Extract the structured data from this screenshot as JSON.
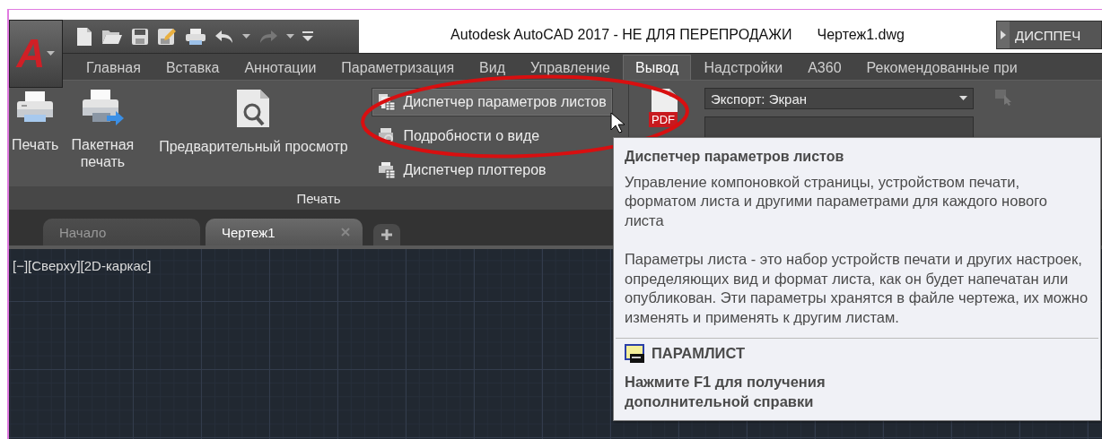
{
  "window": {
    "logo": "A",
    "title": "Autodesk AutoCAD 2017 - НЕ ДЛЯ ПЕРЕПРОДАЖИ",
    "file": "Чертеж1.dwg",
    "search_box": "ДИСППЕЧ"
  },
  "ribbon_tabs": [
    {
      "label": "Главная",
      "selected": false
    },
    {
      "label": "Вставка",
      "selected": false
    },
    {
      "label": "Аннотации",
      "selected": false
    },
    {
      "label": "Параметризация",
      "selected": false
    },
    {
      "label": "Вид",
      "selected": false
    },
    {
      "label": "Управление",
      "selected": false
    },
    {
      "label": "Вывод",
      "selected": true
    },
    {
      "label": "Надстройки",
      "selected": false
    },
    {
      "label": "А360",
      "selected": false
    },
    {
      "label": "Рекомендованные при",
      "selected": false
    }
  ],
  "print_panel": {
    "title": "Печать",
    "large_buttons": [
      {
        "kind": "print",
        "label": "Печать"
      },
      {
        "kind": "batch",
        "label": "Пакетная печать"
      },
      {
        "kind": "preview",
        "label": "Предварительный просмотр"
      }
    ],
    "small_buttons": [
      {
        "kind": "pagesetup",
        "label": "Диспетчер параметров листов",
        "highlighted": true
      },
      {
        "kind": "viewdetails",
        "label": "Подробности о виде",
        "highlighted": false
      },
      {
        "kind": "plotter",
        "label": "Диспетчер плоттеров",
        "highlighted": false
      }
    ]
  },
  "export_panel": {
    "icon_label": "PDF",
    "dropdown": "Экспорт: Экран"
  },
  "document_tabs": [
    {
      "label": "Начало",
      "selected": false,
      "closable": false
    },
    {
      "label": "Чертеж1",
      "selected": true,
      "closable": true
    }
  ],
  "viewport": {
    "label": "[−][Сверху][2D-каркас]"
  },
  "tooltip": {
    "title": "Диспетчер параметров листов",
    "description": "Управление компоновкой страницы, устройством печати, форматом листа и другими параметрами для каждого нового листа",
    "details": "Параметры листа - это набор устройств печати и других настроек, определяющих вид и формат листа, как он будет напечатан или опубликован. Эти параметры хранятся в файле чертежа, их можно изменять и применять к другим листам.",
    "command": "ПАРАМЛИСТ",
    "help": "Нажмите F1 для получения дополнительной справки"
  }
}
